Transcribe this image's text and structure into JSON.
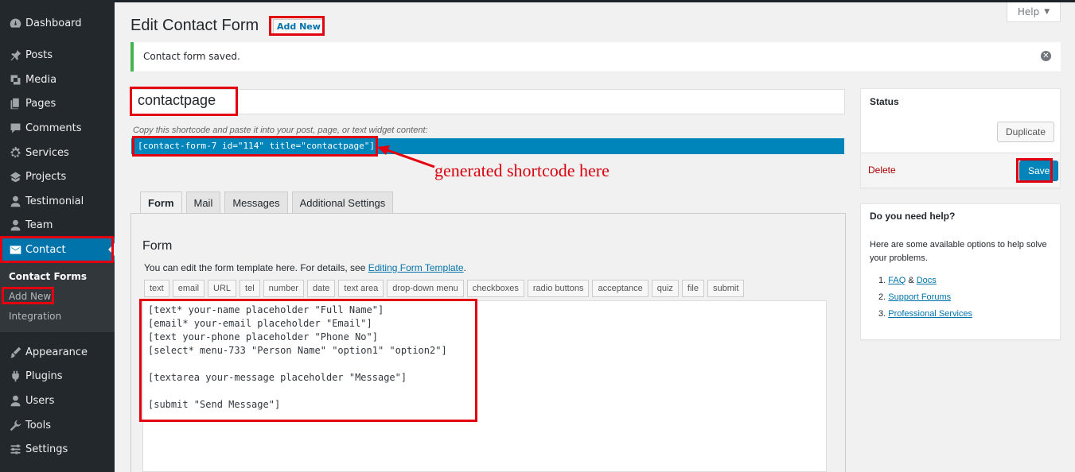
{
  "sidebar": {
    "items": [
      {
        "label": "Dashboard",
        "icon": "dashboard-icon"
      },
      {
        "label": "Posts",
        "icon": "pin-icon"
      },
      {
        "label": "Media",
        "icon": "media-icon"
      },
      {
        "label": "Pages",
        "icon": "pages-icon"
      },
      {
        "label": "Comments",
        "icon": "comment-icon"
      },
      {
        "label": "Services",
        "icon": "gear-icon"
      },
      {
        "label": "Projects",
        "icon": "portfolio-icon"
      },
      {
        "label": "Testimonial",
        "icon": "user-icon"
      },
      {
        "label": "Team",
        "icon": "user-icon"
      },
      {
        "label": "Contact",
        "icon": "mail-icon"
      },
      {
        "label": "Appearance",
        "icon": "brush-icon"
      },
      {
        "label": "Plugins",
        "icon": "plugin-icon"
      },
      {
        "label": "Users",
        "icon": "users-icon"
      },
      {
        "label": "Tools",
        "icon": "wrench-icon"
      },
      {
        "label": "Settings",
        "icon": "settings-icon"
      }
    ],
    "submenu": [
      "Contact Forms",
      "Add New",
      "Integration"
    ]
  },
  "header": {
    "title": "Edit Contact Form",
    "add_new": "Add New",
    "help": "Help"
  },
  "notice": {
    "message": "Contact form saved."
  },
  "form": {
    "title_value": "contactpage",
    "shortcode_hint": "Copy this shortcode and paste it into your post, page, or text widget content:",
    "shortcode": "[contact-form-7 id=\"114\" title=\"contactpage\"]",
    "annotation": "generated shortcode here",
    "tabs": [
      "Form",
      "Mail",
      "Messages",
      "Additional Settings"
    ],
    "panel_title": "Form",
    "panel_desc_prefix": "You can edit the form template here. For details, see ",
    "panel_desc_link": "Editing Form Template",
    "panel_desc_suffix": ".",
    "tag_buttons": [
      "text",
      "email",
      "URL",
      "tel",
      "number",
      "date",
      "text area",
      "drop-down menu",
      "checkboxes",
      "radio buttons",
      "acceptance",
      "quiz",
      "file",
      "submit"
    ],
    "code_lines": [
      "[text* your-name placeholder \"Full Name\"]",
      "[email* your-email placeholder \"Email\"]",
      "[text your-phone placeholder \"Phone No\"]",
      "[select* menu-733 \"Person Name\" \"option1\" \"option2\"]",
      "",
      "[textarea your-message placeholder \"Message\"]",
      "",
      "[submit \"Send Message\"]"
    ]
  },
  "status_box": {
    "title": "Status",
    "duplicate": "Duplicate",
    "delete": "Delete",
    "save": "Save"
  },
  "help_box": {
    "title": "Do you need help?",
    "text": "Here are some available options to help solve your problems.",
    "links": [
      {
        "num": "1.",
        "a": "FAQ",
        "sep": " & ",
        "b": "Docs"
      },
      {
        "num": "2.",
        "a": "Support Forums"
      },
      {
        "num": "3.",
        "a": "Professional Services"
      }
    ]
  },
  "colors": {
    "accent": "#0073aa",
    "primary": "#0085ba",
    "annotation": "#e3000f",
    "success": "#46b450"
  }
}
